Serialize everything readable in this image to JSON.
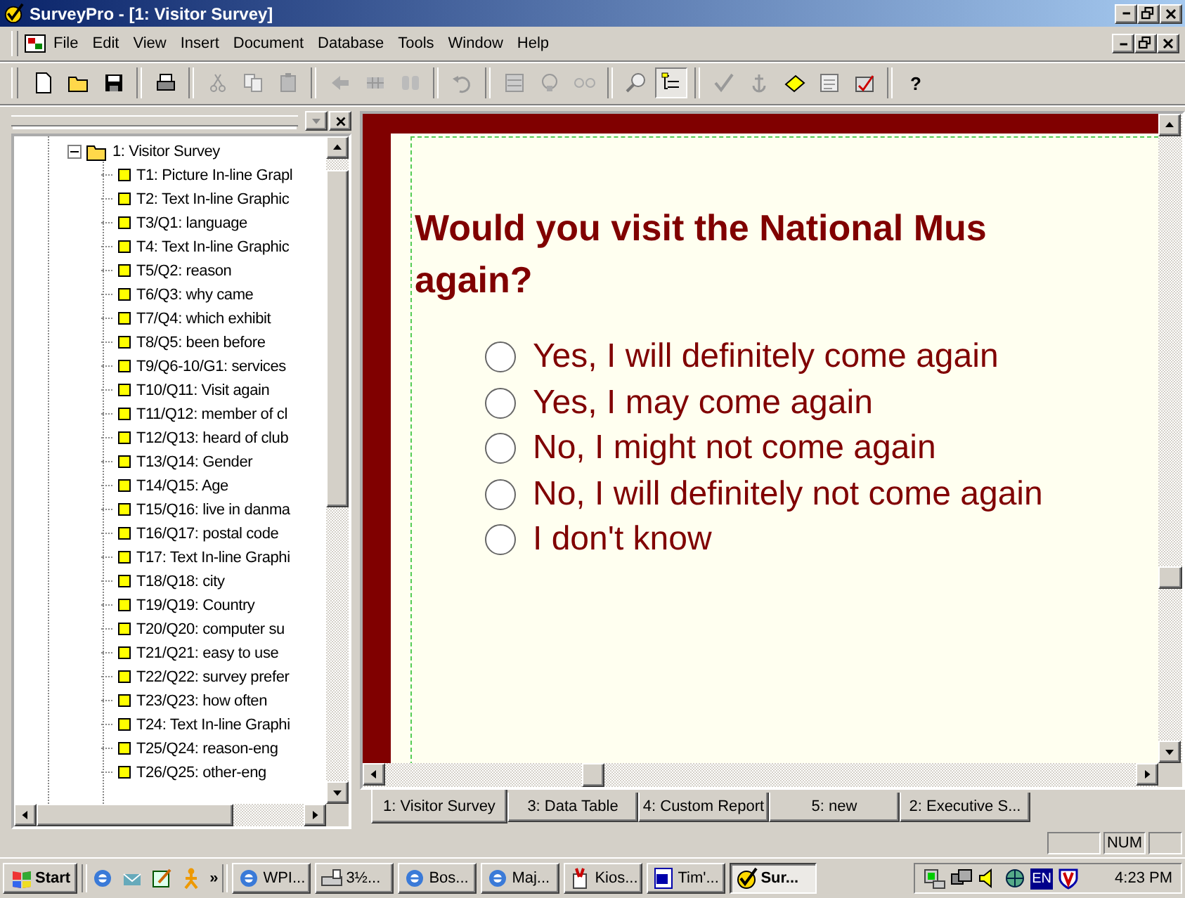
{
  "window": {
    "title": "SurveyPro - [1: Visitor Survey]"
  },
  "menu": [
    {
      "label": "File"
    },
    {
      "label": "Edit"
    },
    {
      "label": "View"
    },
    {
      "label": "Insert"
    },
    {
      "label": "Document"
    },
    {
      "label": "Database"
    },
    {
      "label": "Tools"
    },
    {
      "label": "Window"
    },
    {
      "label": "Help"
    }
  ],
  "toolbar": {
    "tree_view_on": true,
    "help_label": "?"
  },
  "tree": {
    "label": "1: Visitor Survey",
    "expanded": true,
    "children": [
      {
        "label": "T1: Picture In-line Grapl"
      },
      {
        "label": "T2: Text In-line Graphic"
      },
      {
        "label": "T3/Q1: language"
      },
      {
        "label": "T4: Text In-line Graphic"
      },
      {
        "label": "T5/Q2: reason"
      },
      {
        "label": "T6/Q3: why came"
      },
      {
        "label": "T7/Q4: which exhibit"
      },
      {
        "label": "T8/Q5: been before"
      },
      {
        "label": "T9/Q6-10/G1: services"
      },
      {
        "label": "T10/Q11: Visit again"
      },
      {
        "label": "T11/Q12: member of cl"
      },
      {
        "label": "T12/Q13: heard of club"
      },
      {
        "label": "T13/Q14: Gender"
      },
      {
        "label": "T14/Q15: Age"
      },
      {
        "label": "T15/Q16: live in danma"
      },
      {
        "label": "T16/Q17: postal code"
      },
      {
        "label": "T17: Text In-line Graphi"
      },
      {
        "label": "T18/Q18: city"
      },
      {
        "label": "T19/Q19: Country"
      },
      {
        "label": "T20/Q20: computer su"
      },
      {
        "label": "T21/Q21: easy to use"
      },
      {
        "label": "T22/Q22: survey prefer"
      },
      {
        "label": "T23/Q23: how often"
      },
      {
        "label": "T24: Text In-line Graphi"
      },
      {
        "label": "T25/Q24: reason-eng"
      },
      {
        "label": "T26/Q25: other-eng"
      }
    ]
  },
  "document": {
    "question_lines": [
      "Would you visit the National Mus",
      "again?"
    ],
    "options": [
      {
        "label": "Yes, I will definitely come again",
        "selected": false
      },
      {
        "label": "Yes, I may come again",
        "selected": false
      },
      {
        "label": "No, I might not come again",
        "selected": false
      },
      {
        "label": "No, I will definitely not come again",
        "selected": false
      },
      {
        "label": "I don't know",
        "selected": false
      }
    ]
  },
  "tabs": [
    {
      "label": "1: Visitor Survey",
      "selected": true
    },
    {
      "label": "3: Data Table",
      "selected": false
    },
    {
      "label": "4: Custom Report",
      "selected": false
    },
    {
      "label": "5: new",
      "selected": false
    },
    {
      "label": "2: Executive S...",
      "selected": false
    }
  ],
  "status_bar": {
    "indicator": "NUM"
  },
  "taskbar": {
    "start": "Start",
    "more": "»",
    "tasks": [
      {
        "label": "WPI...",
        "kind": "browser",
        "selected": false
      },
      {
        "label": "3½...",
        "kind": "drive",
        "selected": false
      },
      {
        "label": "Bos...",
        "kind": "browser",
        "selected": false
      },
      {
        "label": "Maj...",
        "kind": "browser",
        "selected": false
      },
      {
        "label": "Kios...",
        "kind": "paint",
        "selected": false
      },
      {
        "label": "Tim'...",
        "kind": "word",
        "selected": false
      },
      {
        "label": "Sur...",
        "kind": "survey",
        "selected": true
      }
    ],
    "language": "EN",
    "clock": "4:23 PM"
  }
}
